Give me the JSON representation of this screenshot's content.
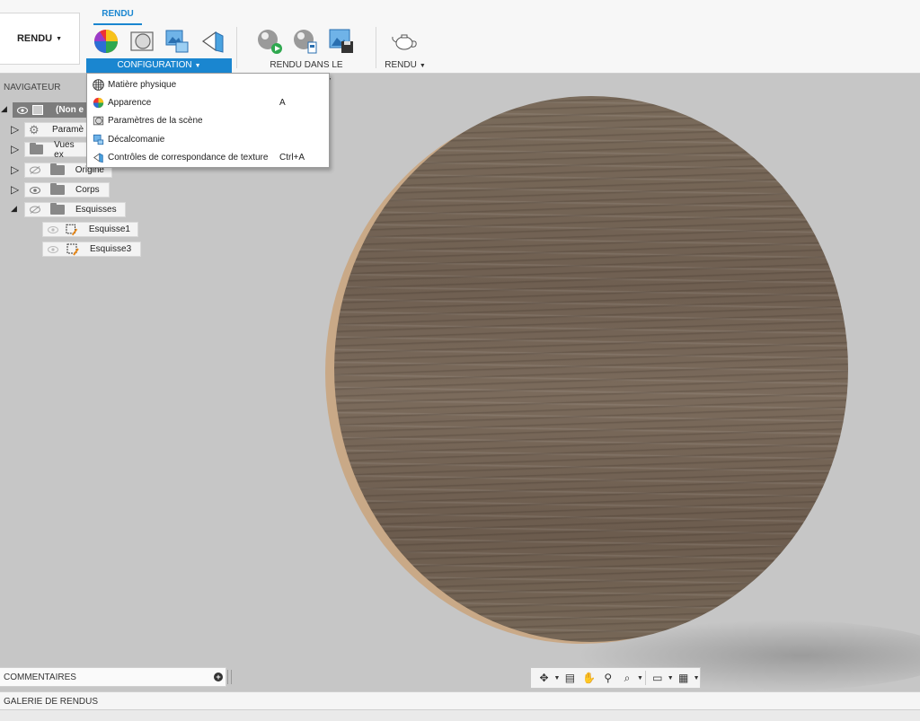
{
  "toolbar": {
    "workspace": "RENDU",
    "active_tab": "RENDU",
    "groups": {
      "configuration": "CONFIGURATION",
      "render_canvas": "RENDU DANS LE CANEVAS",
      "render": "RENDU"
    }
  },
  "config_menu": {
    "items": [
      {
        "label": "Matière physique",
        "shortcut": "",
        "icon": "physical-material-icon"
      },
      {
        "label": "Apparence",
        "shortcut": "A",
        "icon": "appearance-icon"
      },
      {
        "label": "Paramètres de la scène",
        "shortcut": "",
        "icon": "scene-settings-icon"
      },
      {
        "label": "Décalcomanie",
        "shortcut": "",
        "icon": "decal-icon"
      },
      {
        "label": "Contrôles de correspondance de texture",
        "shortcut": "Ctrl+A",
        "icon": "texture-map-controls-icon"
      }
    ]
  },
  "navigator": {
    "title": "NAVIGATEUR",
    "root": "(Non e",
    "items": {
      "params": "Paramè",
      "views": "Vues ex",
      "origin": "Origine",
      "bodies": "Corps",
      "sketches": "Esquisses",
      "sketch1": "Esquisse1",
      "sketch3": "Esquisse3"
    }
  },
  "comments": {
    "label": "COMMENTAIRES"
  },
  "gallery": {
    "label": "GALERIE DE RENDUS"
  },
  "colors": {
    "accent": "#1a86d0",
    "viewport": "#c6c6c6",
    "wood": "#7a6b5b"
  }
}
